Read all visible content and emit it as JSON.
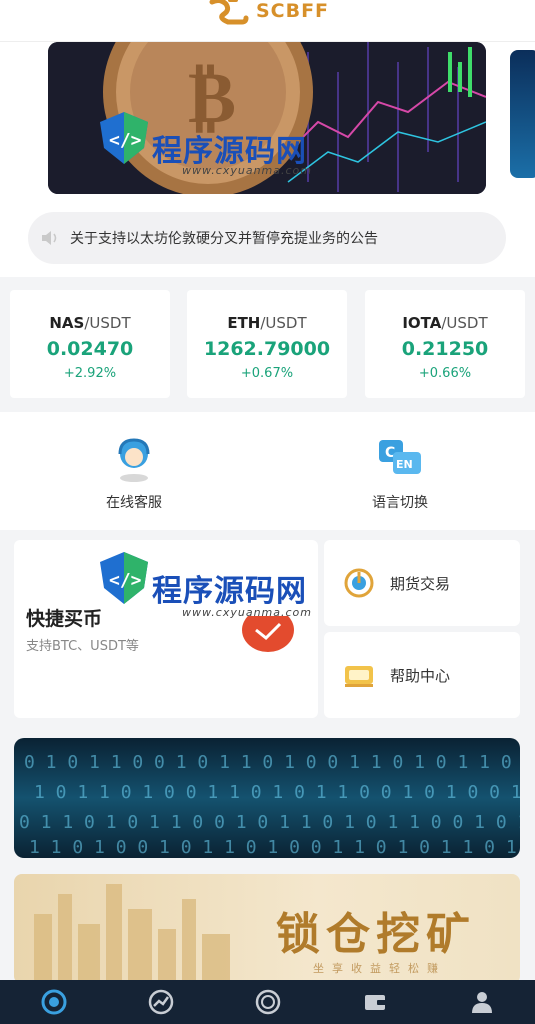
{
  "header": {
    "brand": "SCBFF"
  },
  "notice": {
    "text": "关于支持以太坊伦敦硬分叉并暂停充提业务的公告"
  },
  "tickers": [
    {
      "base": "NAS",
      "quote": "/USDT",
      "price": "0.02470",
      "change": "+2.92%"
    },
    {
      "base": "ETH",
      "quote": "/USDT",
      "price": "1262.79000",
      "change": "+0.67%"
    },
    {
      "base": "IOTA",
      "quote": "/USDT",
      "price": "0.21250",
      "change": "+0.66%"
    }
  ],
  "services": [
    {
      "label": "在线客服",
      "icon": "customer-service-icon"
    },
    {
      "label": "语言切换",
      "icon": "language-switch-icon"
    }
  ],
  "quick_buy": {
    "title": "快捷买币",
    "subtitle": "支持BTC、USDT等"
  },
  "side_cards": [
    {
      "label": "期货交易",
      "icon": "futures-icon"
    },
    {
      "label": "帮助中心",
      "icon": "help-center-icon"
    }
  ],
  "promo2": {
    "title": "锁仓挖矿",
    "subtitle": "坐享收益轻松赚"
  },
  "watermark": {
    "text": "程序源码网",
    "url": "www.cxyuanma.com"
  },
  "bottom_nav": [
    {
      "icon": "home-icon"
    },
    {
      "icon": "market-icon"
    },
    {
      "icon": "trade-icon"
    },
    {
      "icon": "wallet-icon"
    },
    {
      "icon": "profile-icon"
    }
  ],
  "colors": {
    "accent": "#d7902a",
    "up": "#1aa37a",
    "nav_bg": "#152335"
  }
}
